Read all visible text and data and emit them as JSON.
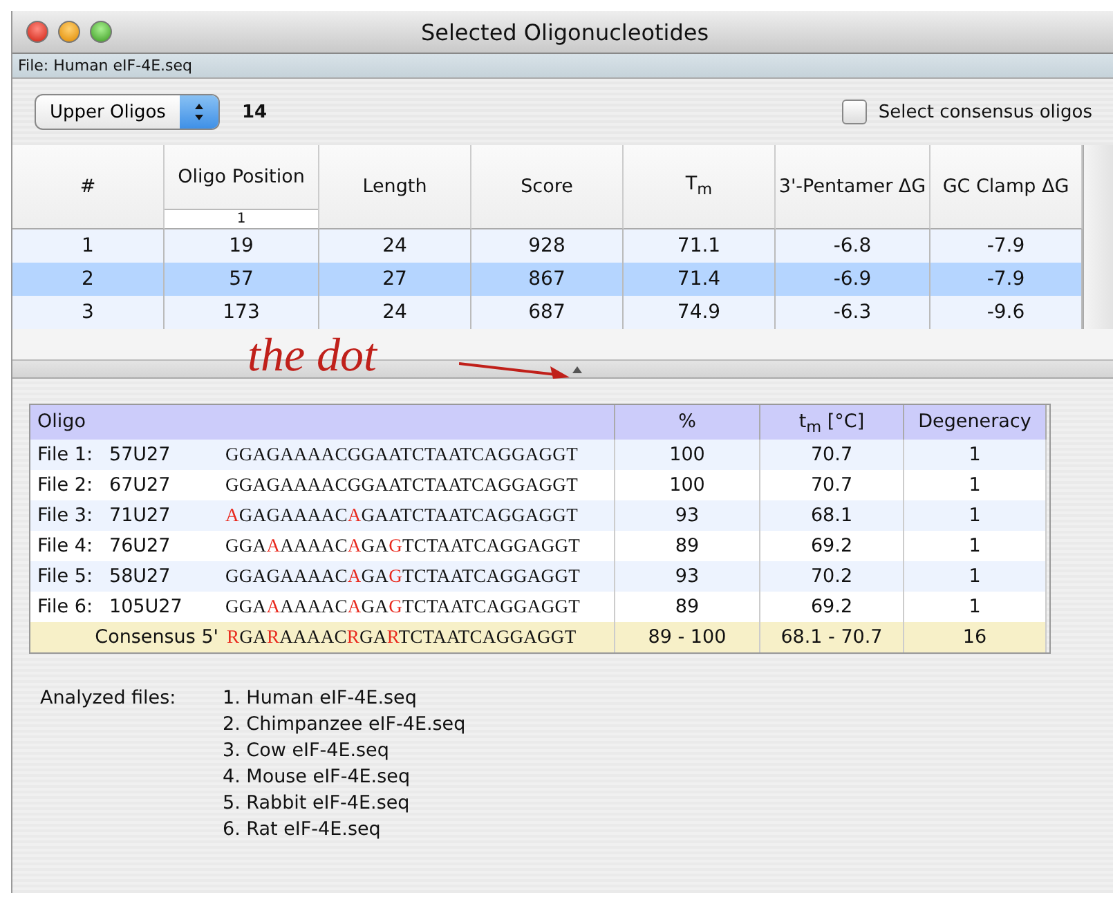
{
  "window": {
    "title": "Selected Oligonucleotides"
  },
  "file_bar": "File: Human eIF-4E.seq",
  "toolbar": {
    "popup": "Upper Oligos",
    "count": "14",
    "consensus_checkbox": {
      "label": "Select consensus oligos",
      "checked": false
    }
  },
  "oligo_table": {
    "columns": [
      "#",
      "Oligo Position",
      "Length",
      "Score",
      "T$_{m}$",
      "3'-Pentamer ΔG",
      "GC Clamp ΔG"
    ],
    "sort_indicator": "1",
    "rows": [
      {
        "cells": [
          "1",
          "19",
          "24",
          "928",
          "71.1",
          "-6.8",
          "-7.9"
        ],
        "selected": false
      },
      {
        "cells": [
          "2",
          "57",
          "27",
          "867",
          "71.4",
          "-6.9",
          "-7.9"
        ],
        "selected": true
      },
      {
        "cells": [
          "3",
          "173",
          "24",
          "687",
          "74.9",
          "-6.3",
          "-9.6"
        ],
        "selected": false
      }
    ]
  },
  "annotation": "the dot",
  "consensus_table": {
    "columns": [
      "Oligo",
      "%",
      "t$_{m}$ [°C]",
      "Degeneracy"
    ],
    "rows": [
      {
        "kind": "file",
        "file": "File 1:",
        "oligo": "57U27",
        "sequence": [
          {
            "text": "GGAGAAAACGGAATCTAATCAGGAGGT",
            "mismatch": false
          }
        ],
        "percent": "100",
        "tm": "70.7",
        "degeneracy": "1"
      },
      {
        "kind": "file",
        "file": "File 2:",
        "oligo": "67U27",
        "sequence": [
          {
            "text": "GGAGAAAACGGAATCTAATCAGGAGGT",
            "mismatch": false
          }
        ],
        "percent": "100",
        "tm": "70.7",
        "degeneracy": "1"
      },
      {
        "kind": "file",
        "file": "File 3:",
        "oligo": "71U27",
        "sequence": [
          {
            "text": "A",
            "mismatch": true
          },
          {
            "text": "GAGAAAAC",
            "mismatch": false
          },
          {
            "text": "A",
            "mismatch": true
          },
          {
            "text": "GAATCTAATCAGGAGGT",
            "mismatch": false
          }
        ],
        "percent": "93",
        "tm": "68.1",
        "degeneracy": "1"
      },
      {
        "kind": "file",
        "file": "File 4:",
        "oligo": "76U27",
        "sequence": [
          {
            "text": "GGA",
            "mismatch": false
          },
          {
            "text": "A",
            "mismatch": true
          },
          {
            "text": "AAAAC",
            "mismatch": false
          },
          {
            "text": "A",
            "mismatch": true
          },
          {
            "text": "GA",
            "mismatch": false
          },
          {
            "text": "G",
            "mismatch": true
          },
          {
            "text": "TCTAATCAGGAGGT",
            "mismatch": false
          }
        ],
        "percent": "89",
        "tm": "69.2",
        "degeneracy": "1"
      },
      {
        "kind": "file",
        "file": "File 5:",
        "oligo": "58U27",
        "sequence": [
          {
            "text": "GGAGAAAAC",
            "mismatch": false
          },
          {
            "text": "A",
            "mismatch": true
          },
          {
            "text": "GA",
            "mismatch": false
          },
          {
            "text": "G",
            "mismatch": true
          },
          {
            "text": "TCTAATCAGGAGGT",
            "mismatch": false
          }
        ],
        "percent": "93",
        "tm": "70.2",
        "degeneracy": "1"
      },
      {
        "kind": "file",
        "file": "File 6:",
        "oligo": "105U27",
        "sequence": [
          {
            "text": "GGA",
            "mismatch": false
          },
          {
            "text": "A",
            "mismatch": true
          },
          {
            "text": "AAAAC",
            "mismatch": false
          },
          {
            "text": "A",
            "mismatch": true
          },
          {
            "text": "GA",
            "mismatch": false
          },
          {
            "text": "G",
            "mismatch": true
          },
          {
            "text": "TCTAATCAGGAGGT",
            "mismatch": false
          }
        ],
        "percent": "89",
        "tm": "69.2",
        "degeneracy": "1"
      },
      {
        "kind": "consensus",
        "label": "Consensus 5'",
        "sequence": [
          {
            "text": "R",
            "mismatch": true
          },
          {
            "text": "GA",
            "mismatch": false
          },
          {
            "text": "R",
            "mismatch": true
          },
          {
            "text": "AAAAC",
            "mismatch": false
          },
          {
            "text": "R",
            "mismatch": true
          },
          {
            "text": "GA",
            "mismatch": false
          },
          {
            "text": "R",
            "mismatch": true
          },
          {
            "text": "TCTAATCAGGAGGT",
            "mismatch": false
          }
        ],
        "percent": "89 - 100",
        "tm": "68.1 - 70.7",
        "degeneracy": "16"
      }
    ]
  },
  "analyzed_files": {
    "label": "Analyzed files:",
    "files": [
      "1. Human eIF-4E.seq",
      "2. Chimpanzee eIF-4E.seq",
      "3. Cow eIF-4E.seq",
      "4. Mouse eIF-4E.seq",
      "5. Rabbit eIF-4E.seq",
      "6. Rat eIF-4E.seq"
    ]
  }
}
